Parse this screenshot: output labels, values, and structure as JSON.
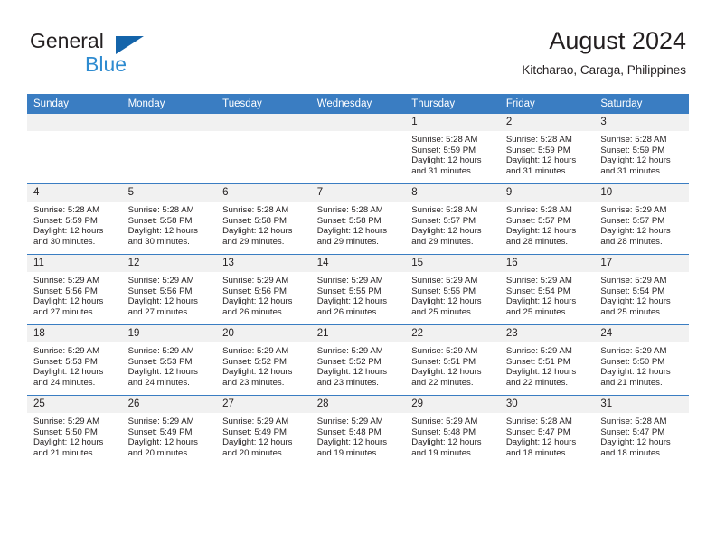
{
  "brand": {
    "name_top": "General",
    "name_bottom": "Blue",
    "accent_color": "#1464aa",
    "blue_text_color": "#2e8bd0"
  },
  "header": {
    "title": "August 2024",
    "subtitle": "Kitcharao, Caraga, Philippines"
  },
  "calendar": {
    "header_bg": "#3a7dc2",
    "daynum_bg": "#f1f1f1",
    "weekday_headers": [
      "Sunday",
      "Monday",
      "Tuesday",
      "Wednesday",
      "Thursday",
      "Friday",
      "Saturday"
    ],
    "weeks": [
      [
        {
          "day": "",
          "sunrise": "",
          "sunset": "",
          "daylight_line1": "",
          "daylight_line2": ""
        },
        {
          "day": "",
          "sunrise": "",
          "sunset": "",
          "daylight_line1": "",
          "daylight_line2": ""
        },
        {
          "day": "",
          "sunrise": "",
          "sunset": "",
          "daylight_line1": "",
          "daylight_line2": ""
        },
        {
          "day": "",
          "sunrise": "",
          "sunset": "",
          "daylight_line1": "",
          "daylight_line2": ""
        },
        {
          "day": "1",
          "sunrise": "Sunrise: 5:28 AM",
          "sunset": "Sunset: 5:59 PM",
          "daylight_line1": "Daylight: 12 hours",
          "daylight_line2": "and 31 minutes."
        },
        {
          "day": "2",
          "sunrise": "Sunrise: 5:28 AM",
          "sunset": "Sunset: 5:59 PM",
          "daylight_line1": "Daylight: 12 hours",
          "daylight_line2": "and 31 minutes."
        },
        {
          "day": "3",
          "sunrise": "Sunrise: 5:28 AM",
          "sunset": "Sunset: 5:59 PM",
          "daylight_line1": "Daylight: 12 hours",
          "daylight_line2": "and 31 minutes."
        }
      ],
      [
        {
          "day": "4",
          "sunrise": "Sunrise: 5:28 AM",
          "sunset": "Sunset: 5:59 PM",
          "daylight_line1": "Daylight: 12 hours",
          "daylight_line2": "and 30 minutes."
        },
        {
          "day": "5",
          "sunrise": "Sunrise: 5:28 AM",
          "sunset": "Sunset: 5:58 PM",
          "daylight_line1": "Daylight: 12 hours",
          "daylight_line2": "and 30 minutes."
        },
        {
          "day": "6",
          "sunrise": "Sunrise: 5:28 AM",
          "sunset": "Sunset: 5:58 PM",
          "daylight_line1": "Daylight: 12 hours",
          "daylight_line2": "and 29 minutes."
        },
        {
          "day": "7",
          "sunrise": "Sunrise: 5:28 AM",
          "sunset": "Sunset: 5:58 PM",
          "daylight_line1": "Daylight: 12 hours",
          "daylight_line2": "and 29 minutes."
        },
        {
          "day": "8",
          "sunrise": "Sunrise: 5:28 AM",
          "sunset": "Sunset: 5:57 PM",
          "daylight_line1": "Daylight: 12 hours",
          "daylight_line2": "and 29 minutes."
        },
        {
          "day": "9",
          "sunrise": "Sunrise: 5:28 AM",
          "sunset": "Sunset: 5:57 PM",
          "daylight_line1": "Daylight: 12 hours",
          "daylight_line2": "and 28 minutes."
        },
        {
          "day": "10",
          "sunrise": "Sunrise: 5:29 AM",
          "sunset": "Sunset: 5:57 PM",
          "daylight_line1": "Daylight: 12 hours",
          "daylight_line2": "and 28 minutes."
        }
      ],
      [
        {
          "day": "11",
          "sunrise": "Sunrise: 5:29 AM",
          "sunset": "Sunset: 5:56 PM",
          "daylight_line1": "Daylight: 12 hours",
          "daylight_line2": "and 27 minutes."
        },
        {
          "day": "12",
          "sunrise": "Sunrise: 5:29 AM",
          "sunset": "Sunset: 5:56 PM",
          "daylight_line1": "Daylight: 12 hours",
          "daylight_line2": "and 27 minutes."
        },
        {
          "day": "13",
          "sunrise": "Sunrise: 5:29 AM",
          "sunset": "Sunset: 5:56 PM",
          "daylight_line1": "Daylight: 12 hours",
          "daylight_line2": "and 26 minutes."
        },
        {
          "day": "14",
          "sunrise": "Sunrise: 5:29 AM",
          "sunset": "Sunset: 5:55 PM",
          "daylight_line1": "Daylight: 12 hours",
          "daylight_line2": "and 26 minutes."
        },
        {
          "day": "15",
          "sunrise": "Sunrise: 5:29 AM",
          "sunset": "Sunset: 5:55 PM",
          "daylight_line1": "Daylight: 12 hours",
          "daylight_line2": "and 25 minutes."
        },
        {
          "day": "16",
          "sunrise": "Sunrise: 5:29 AM",
          "sunset": "Sunset: 5:54 PM",
          "daylight_line1": "Daylight: 12 hours",
          "daylight_line2": "and 25 minutes."
        },
        {
          "day": "17",
          "sunrise": "Sunrise: 5:29 AM",
          "sunset": "Sunset: 5:54 PM",
          "daylight_line1": "Daylight: 12 hours",
          "daylight_line2": "and 25 minutes."
        }
      ],
      [
        {
          "day": "18",
          "sunrise": "Sunrise: 5:29 AM",
          "sunset": "Sunset: 5:53 PM",
          "daylight_line1": "Daylight: 12 hours",
          "daylight_line2": "and 24 minutes."
        },
        {
          "day": "19",
          "sunrise": "Sunrise: 5:29 AM",
          "sunset": "Sunset: 5:53 PM",
          "daylight_line1": "Daylight: 12 hours",
          "daylight_line2": "and 24 minutes."
        },
        {
          "day": "20",
          "sunrise": "Sunrise: 5:29 AM",
          "sunset": "Sunset: 5:52 PM",
          "daylight_line1": "Daylight: 12 hours",
          "daylight_line2": "and 23 minutes."
        },
        {
          "day": "21",
          "sunrise": "Sunrise: 5:29 AM",
          "sunset": "Sunset: 5:52 PM",
          "daylight_line1": "Daylight: 12 hours",
          "daylight_line2": "and 23 minutes."
        },
        {
          "day": "22",
          "sunrise": "Sunrise: 5:29 AM",
          "sunset": "Sunset: 5:51 PM",
          "daylight_line1": "Daylight: 12 hours",
          "daylight_line2": "and 22 minutes."
        },
        {
          "day": "23",
          "sunrise": "Sunrise: 5:29 AM",
          "sunset": "Sunset: 5:51 PM",
          "daylight_line1": "Daylight: 12 hours",
          "daylight_line2": "and 22 minutes."
        },
        {
          "day": "24",
          "sunrise": "Sunrise: 5:29 AM",
          "sunset": "Sunset: 5:50 PM",
          "daylight_line1": "Daylight: 12 hours",
          "daylight_line2": "and 21 minutes."
        }
      ],
      [
        {
          "day": "25",
          "sunrise": "Sunrise: 5:29 AM",
          "sunset": "Sunset: 5:50 PM",
          "daylight_line1": "Daylight: 12 hours",
          "daylight_line2": "and 21 minutes."
        },
        {
          "day": "26",
          "sunrise": "Sunrise: 5:29 AM",
          "sunset": "Sunset: 5:49 PM",
          "daylight_line1": "Daylight: 12 hours",
          "daylight_line2": "and 20 minutes."
        },
        {
          "day": "27",
          "sunrise": "Sunrise: 5:29 AM",
          "sunset": "Sunset: 5:49 PM",
          "daylight_line1": "Daylight: 12 hours",
          "daylight_line2": "and 20 minutes."
        },
        {
          "day": "28",
          "sunrise": "Sunrise: 5:29 AM",
          "sunset": "Sunset: 5:48 PM",
          "daylight_line1": "Daylight: 12 hours",
          "daylight_line2": "and 19 minutes."
        },
        {
          "day": "29",
          "sunrise": "Sunrise: 5:29 AM",
          "sunset": "Sunset: 5:48 PM",
          "daylight_line1": "Daylight: 12 hours",
          "daylight_line2": "and 19 minutes."
        },
        {
          "day": "30",
          "sunrise": "Sunrise: 5:28 AM",
          "sunset": "Sunset: 5:47 PM",
          "daylight_line1": "Daylight: 12 hours",
          "daylight_line2": "and 18 minutes."
        },
        {
          "day": "31",
          "sunrise": "Sunrise: 5:28 AM",
          "sunset": "Sunset: 5:47 PM",
          "daylight_line1": "Daylight: 12 hours",
          "daylight_line2": "and 18 minutes."
        }
      ]
    ]
  }
}
